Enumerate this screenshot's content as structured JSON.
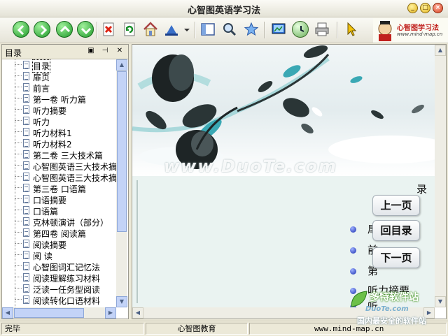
{
  "window": {
    "title": "心智图英语学习法"
  },
  "toolbar": {
    "buttons": [
      "back-icon",
      "forward-icon",
      "up-icon",
      "download-icon",
      "stop-icon",
      "refresh-icon",
      "home-icon",
      "print-preview-icon",
      "dropdown-icon",
      "toc-icon",
      "search-icon",
      "favorites-icon",
      "screen-icon",
      "history-icon",
      "printer-icon",
      "cursor-icon"
    ]
  },
  "brand": {
    "logo_text": "心智图学习法",
    "logo_url": "www.mind-map.cn"
  },
  "sidebar": {
    "title": "目录",
    "items": [
      "目录",
      "扉页",
      "前言",
      "第一卷 听力篇",
      "听力摘要",
      "听力",
      "听力材料1",
      "听力材料2",
      "第二卷 三大技术篇",
      "心智图英语三大技术摘",
      "心智图英语三大技术摘",
      "第三卷 口语篇",
      "口语摘要",
      "口语篇",
      "克林顿演讲（部分）",
      "第四卷 阅读篇",
      "阅读摘要",
      "阅 读",
      "心智图词汇记忆法",
      "阅读理解练习材料",
      "泛读一任务型阅读",
      "阅读转化口语材料"
    ]
  },
  "content": {
    "watermark": "www.DuoTe.com",
    "toc_heading_fragment": "录",
    "bullets": [
      "扉",
      "前",
      "第",
      "听力摘要",
      "听"
    ],
    "nav": {
      "prev": "上一页",
      "toc": "回目录",
      "next": "下一页"
    }
  },
  "status": {
    "left": "完毕",
    "middle": "心智图教育",
    "right": "www.mind-map.cn"
  },
  "corner_badge": {
    "line1": "多特软件站",
    "line2": "DuoTe.com",
    "line3": "国内最安全的软件站"
  }
}
